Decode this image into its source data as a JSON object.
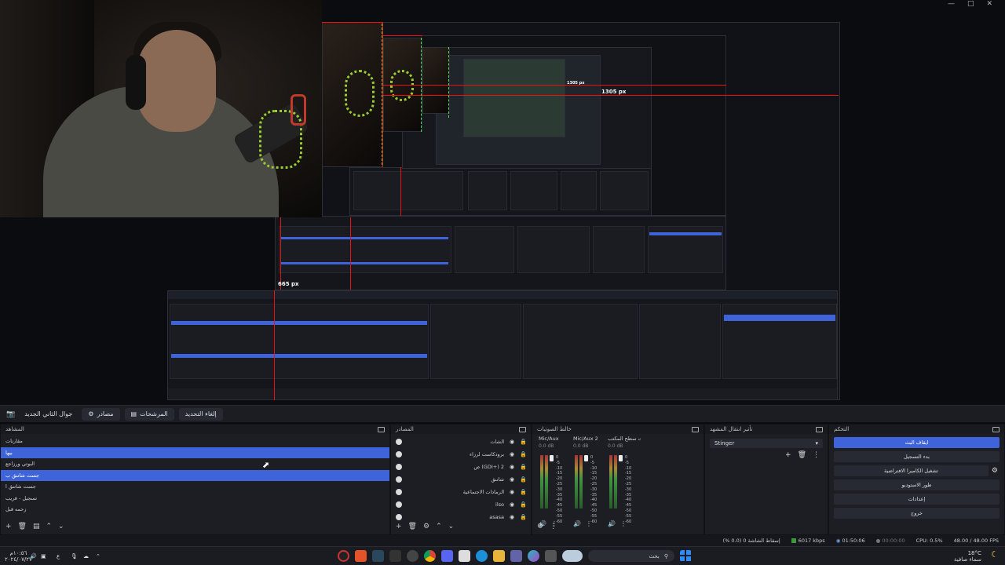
{
  "preview": {
    "measure_label_large": "1305 px",
    "measure_label_mid": "1305 px",
    "measure_label_small": "665 px"
  },
  "toolbar": {
    "camera_tab": "جوال الثاني الجديد",
    "filters_button": "مصادر",
    "filters2_button": "المرشحات",
    "properties_button": "إلغاء التحديد"
  },
  "scenes": {
    "title": "المشاهد",
    "items": [
      {
        "label": "مقارنات",
        "selected": false
      },
      {
        "label": "بيها",
        "selected": true
      },
      {
        "label": "البوتي ورزاجع",
        "selected": false
      },
      {
        "label": "جست شاتنق ب",
        "selected": true
      },
      {
        "label": "جست شاتنق ا",
        "selected": false
      },
      {
        "label": "تسجيل - قريب",
        "selected": false
      },
      {
        "label": "زحمه قبل",
        "selected": false
      }
    ]
  },
  "sources": {
    "title": "المصادر",
    "items": [
      {
        "label": "الشات"
      },
      {
        "label": "برودكاست لرزاء"
      },
      {
        "label": "ص (GDI+) 2"
      },
      {
        "label": "شاتنق"
      },
      {
        "label": "الرمادات الاجتماعية"
      },
      {
        "label": "ilso"
      },
      {
        "label": "asasa"
      }
    ]
  },
  "mixer": {
    "title": "خالط الصوتيات",
    "channels": [
      {
        "name": "Mic/Aux",
        "db": "0.0 dB"
      },
      {
        "name": "Mic/Aux 2",
        "db": "0.0 dB"
      },
      {
        "name": "صوت سطح المكتب",
        "db": "0.0 dB"
      }
    ],
    "scale": [
      "0",
      "-5",
      "-10",
      "-15",
      "-20",
      "-25",
      "-30",
      "-35",
      "-40",
      "-45",
      "-50",
      "-55",
      "-60"
    ]
  },
  "transitions": {
    "title": "تأثير انتقال المشهد",
    "selected": "Stinger"
  },
  "controls": {
    "title": "التحكم",
    "buttons": [
      "ايقاف البث",
      "بدء التسجيل",
      "تشغيل الكاميرا الافتراضية",
      "طور الاستوديو",
      "إعدادات",
      "خروج"
    ]
  },
  "status": {
    "dropped": "إسقاط الشاشة 0 (0.0 %)",
    "bitrate": "6017 kbps",
    "live": "01:50:06",
    "rec": "00:00:00",
    "cpu": "CPU: 0.5%",
    "fps": "48.00 / 48.00 FPS"
  },
  "taskbar": {
    "time": "١٠:٥٦م",
    "date": "٢٠٢٤/٠٧/٢٧",
    "lang": "ع",
    "search_label": "بحث",
    "weather_temp": "18°C",
    "weather_desc": "سماء صافية"
  },
  "colors": {
    "accent": "#3f63d8",
    "panel": "#1c1e24",
    "background": "#0b0c10"
  }
}
